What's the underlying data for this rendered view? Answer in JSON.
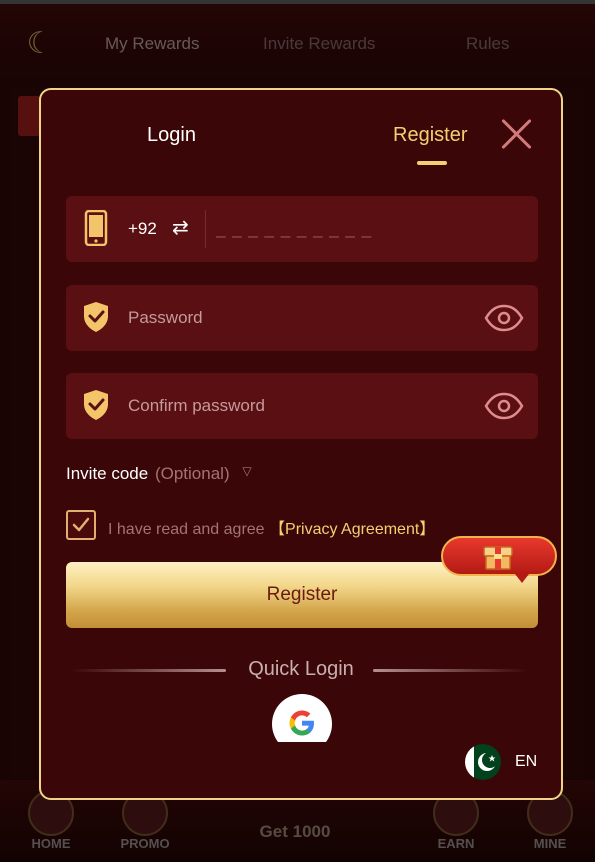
{
  "background": {
    "tabs": [
      "My Rewards",
      "Invite Rewards",
      "Rules"
    ],
    "nav": [
      "HOME",
      "PROMO",
      "EARN",
      "MINE"
    ],
    "center_label": "Get 1000"
  },
  "modal": {
    "tabs": {
      "login": "Login",
      "register": "Register"
    },
    "active_tab": "Register",
    "phone": {
      "country_code": "+92",
      "placeholder": "_ _ _ _ _ _ _ _ _ _"
    },
    "password": {
      "placeholder": "Password"
    },
    "confirm": {
      "placeholder": "Confirm password"
    },
    "invite": {
      "label": "Invite code",
      "optional": "(Optional)"
    },
    "agree": {
      "text": "I have read and agree",
      "link": "【Privacy Agreement】",
      "checked": true
    },
    "register_button": "Register",
    "quick_login": "Quick Login",
    "language": "EN"
  },
  "colors": {
    "accent": "#f6cf72",
    "modal_bg": "#3b0607",
    "field_bg": "#5a0f12",
    "border": "#f0d48a"
  },
  "icons": [
    "phone-icon",
    "swap-icon",
    "shield-icon",
    "eye-icon",
    "check-icon",
    "gift-icon",
    "google-icon",
    "flag-icon",
    "close-icon"
  ]
}
